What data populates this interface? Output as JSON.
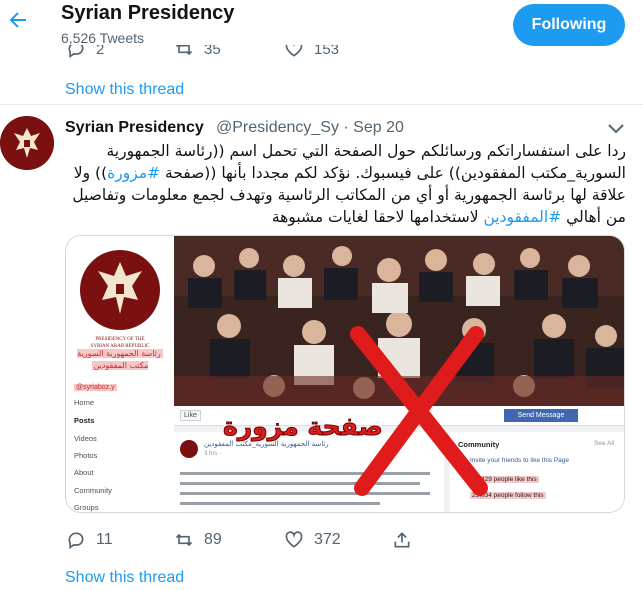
{
  "header": {
    "title": "Syrian Presidency",
    "tweet_count": "6,526 Tweets",
    "follow_label": "Following",
    "back_icon": "back-arrow-icon"
  },
  "prev_tweet": {
    "replies": "2",
    "retweets": "35",
    "likes": "153"
  },
  "thread_link_1": "Show this thread",
  "tweet": {
    "name": "Syrian Presidency",
    "handle": "@Presidency_Sy · Sep 20",
    "text_before_tag1": "ردا على استفساراتكم ورسائلكم حول الصفحة التي تحمل اسم ((رئاسة الجمهورية السورية_مكتب المفقودين)) على فيسبوك. نؤكد لكم مجددا بأنها ((صفحة ",
    "tag1": "#مزورة",
    "text_between": ")) ولا علاقة لها برئاسة الجمهورية أو أي من المكاتب الرئاسية وتهدف لجمع معلومات وتفاصيل من أهالي ",
    "tag2": "#المفقودين",
    "text_after_tag2": " لاستخدامها لاحقا لغايات مشبوهة",
    "media": {
      "stamp_text": "صفحة مزورة",
      "fb_page_name": "رئاسة الجمهورية السورية مكتب المفقودين",
      "fb_handle": "@syriaboz.y",
      "fb_menu": [
        "Home",
        "Posts",
        "Videos",
        "Photos",
        "About",
        "Community",
        "Groups"
      ],
      "fb_like": "Like",
      "fb_send": "Send Message",
      "fb_post_name": "رئاسة الجمهورية السورية_مكتب المفقودين",
      "fb_post_time": "3 hrs ·",
      "fb_community": "Community",
      "fb_see_all": "See All",
      "fb_invite": "Invite your friends to like this Page",
      "fb_stat_likes": "27,429 people like this",
      "fb_stat_follows": "25,034 people follow this",
      "logo_caption_1": "PRESIDENCY OF THE",
      "logo_caption_2": "SYRIAN ARAB REPUBLIC"
    },
    "actions": {
      "replies": "11",
      "retweets": "89",
      "likes": "372"
    }
  },
  "thread_link_2": "Show this thread",
  "colors": {
    "accent": "#1d9bf0",
    "text": "#0f1419",
    "secondary": "#536471",
    "stamp_red": "#e01b1b"
  }
}
